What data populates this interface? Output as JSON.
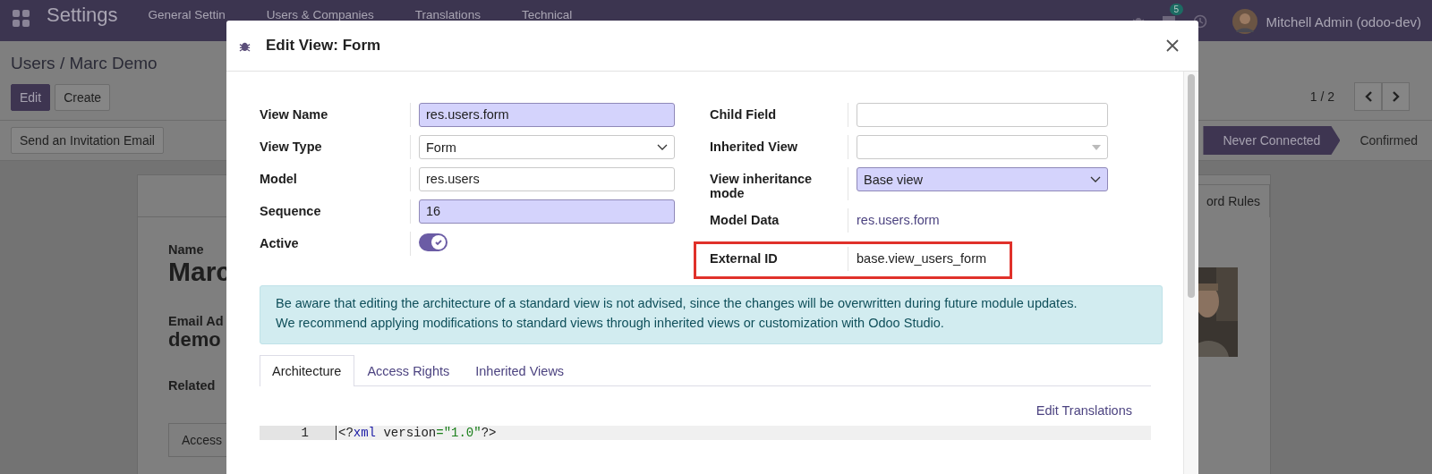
{
  "navbar": {
    "app_title": "Settings",
    "menu": [
      "General Settin",
      "Users & Companies",
      "Translations",
      "Technical"
    ],
    "message_count": "5",
    "user": "Mitchell Admin (odoo-dev)"
  },
  "breadcrumb": "Users / Marc Demo",
  "buttons": [
    {
      "label": "Edit",
      "primary": true
    },
    {
      "label": "Create",
      "primary": false
    }
  ],
  "pager": "1 / 2",
  "action_button": "Send an Invitation Email",
  "statusbar": [
    {
      "label": "Never Connected",
      "selected": true
    },
    {
      "label": "Confirmed",
      "selected": false
    }
  ],
  "record": {
    "name_label": "Name",
    "name": "Marc",
    "email_label": "Email Ad",
    "email": "demo",
    "related_label": "Related",
    "tab": "Access",
    "side_tab": "ord Rules"
  },
  "dialog": {
    "title": "Edit View: Form",
    "fields_left": [
      {
        "label": "View Name",
        "kind": "text",
        "value": "res.users.form",
        "required": true
      },
      {
        "label": "View Type",
        "kind": "select",
        "value": "Form",
        "required": false
      },
      {
        "label": "Model",
        "kind": "text",
        "value": "res.users",
        "required": false
      },
      {
        "label": "Sequence",
        "kind": "text",
        "value": "16",
        "required": true
      },
      {
        "label": "Active",
        "kind": "toggle",
        "on": true
      }
    ],
    "fields_right": [
      {
        "label": "Child Field",
        "kind": "text",
        "required": false,
        "highlighted": false
      },
      {
        "label": "Inherited View",
        "kind": "combo",
        "required": false,
        "highlighted": false
      },
      {
        "label": "View inheritance mode",
        "kind": "select",
        "value": "Base view",
        "required": true,
        "highlighted": false
      },
      {
        "label": "Model Data",
        "kind": "link",
        "value": "res.users.form",
        "highlighted": false
      },
      {
        "label": "External ID",
        "kind": "plain",
        "value": "base.view_users_form",
        "highlighted": true
      }
    ],
    "alert": [
      "Be aware that editing the architecture of a standard view is not advised, since the changes will be overwritten during future module updates.",
      "We recommend applying modifications to standard views through inherited views or customization with Odoo Studio."
    ],
    "tabs": [
      {
        "label": "Architecture",
        "selected": true
      },
      {
        "label": "Access Rights",
        "selected": false
      },
      {
        "label": "Inherited Views",
        "selected": false
      }
    ],
    "edit_translations": "Edit Translations",
    "code": [
      {
        "number": "1",
        "tokens": [
          {
            "text": "<?",
            "kind": "punct"
          },
          {
            "text": "xml",
            "kind": "tag"
          },
          {
            "text": " version",
            "kind": "attr"
          },
          {
            "text": "=\"1.0\"",
            "kind": "string"
          },
          {
            "text": "?>",
            "kind": "punct"
          }
        ]
      }
    ]
  }
}
